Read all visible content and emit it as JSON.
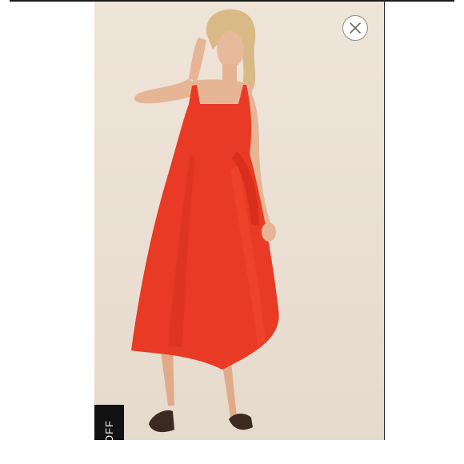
{
  "listing": {
    "close_icon": "close-icon",
    "badge_text": "OFF",
    "colors": {
      "dress": "#e83a24",
      "background": "#ede2d6",
      "badge": "#111111"
    }
  }
}
